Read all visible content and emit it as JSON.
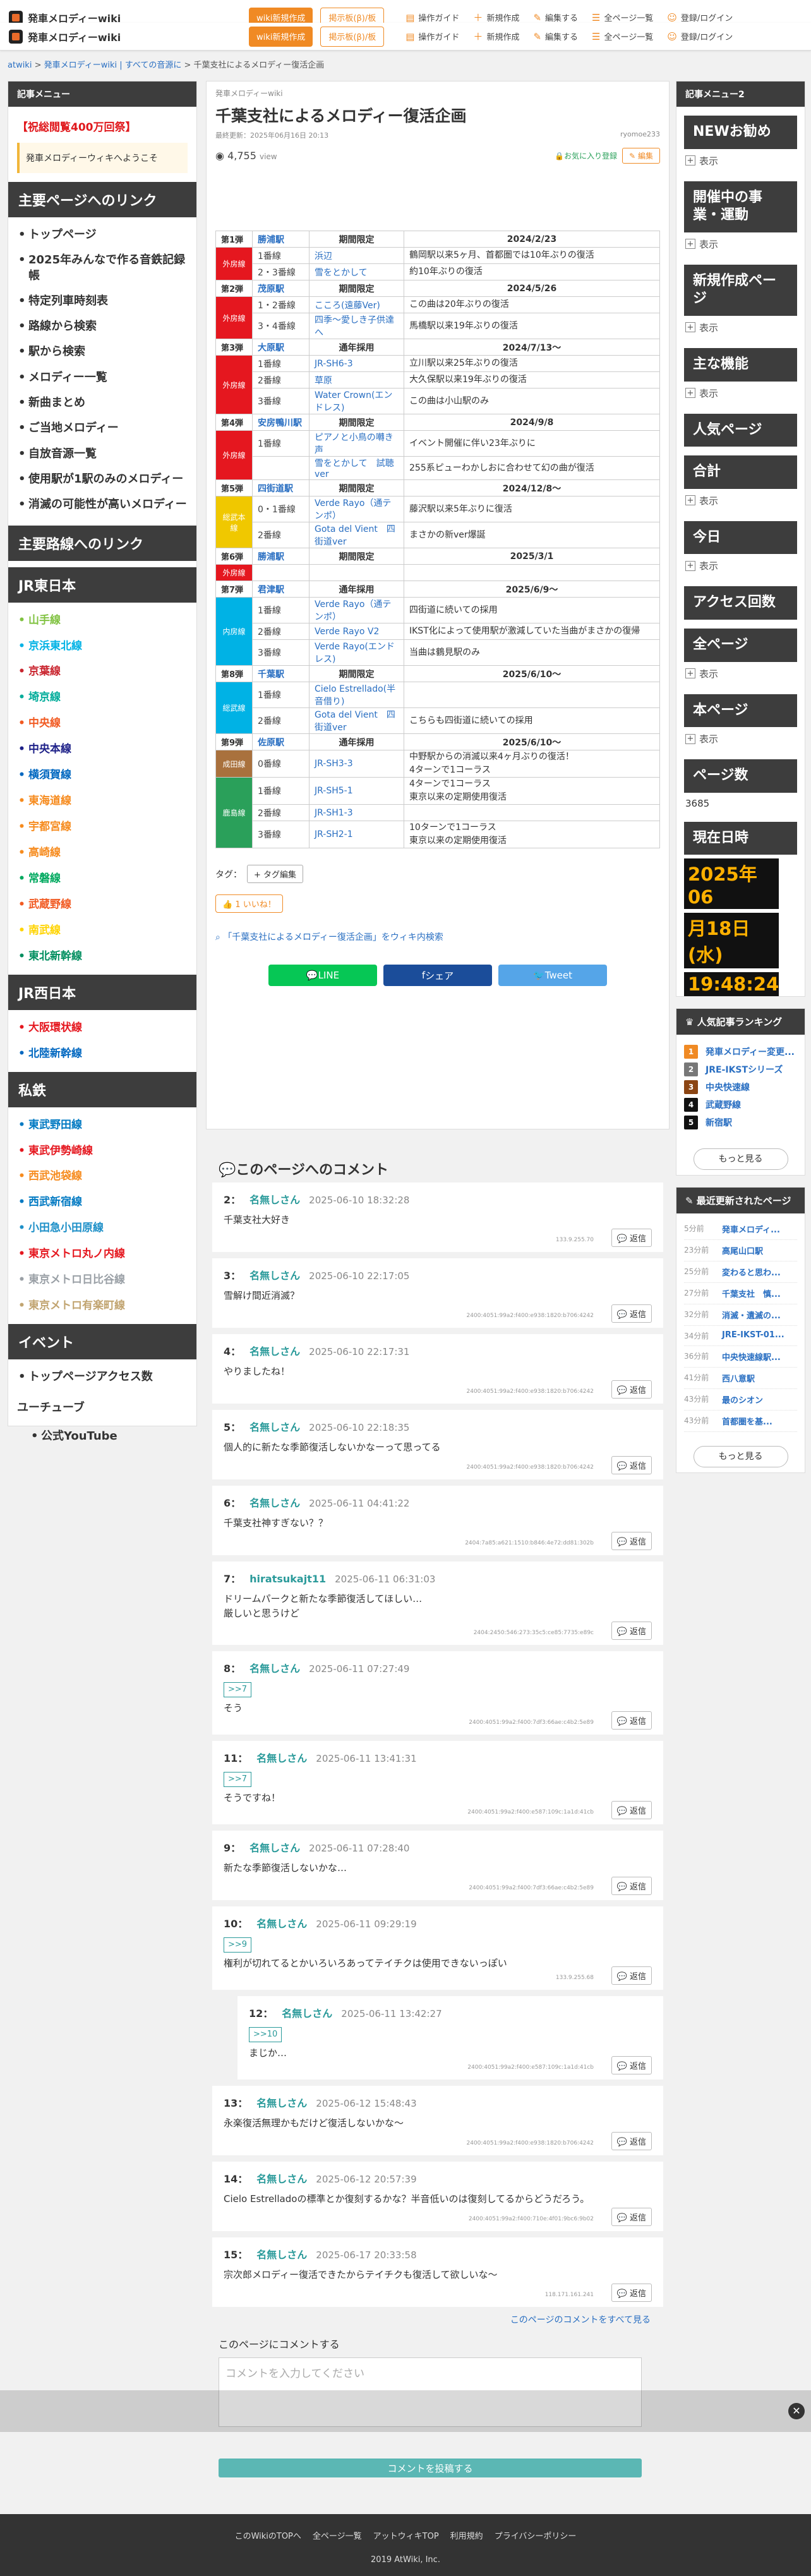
{
  "header": {
    "site_name": "発車メロディーwiki",
    "btn_wiki": "wiki新規作成",
    "btn_ad": "掲示板(β)/板",
    "links": [
      "操作ガイド",
      "新規作成",
      "編集する",
      "全ページ一覧",
      "登録/ログイン"
    ]
  },
  "breadcrumb": {
    "items": [
      "atwiki",
      "発車メロディーwiki | すべての音源に",
      "千葉支社によるメロディー復活企画"
    ]
  },
  "left": {
    "header": "記事メニュー",
    "notice": "【祝総閲覧400万回祭】",
    "welcome": "発車メロディーウィキへようこそ",
    "main_links_hd": "主要ページへのリンク",
    "main_links": [
      "トップページ",
      "2025年みんなで作る音鉄記録帳",
      "特定列車時刻表",
      "路線から検索",
      "駅から検索",
      "メロディー一覧",
      "新曲まとめ",
      "ご当地メロディー",
      "自放音源一覧",
      "使用駅が1駅のみのメロディー",
      "消滅の可能性が高いメロディー"
    ],
    "route_links_hd": "主要路線へのリンク",
    "jre_hd": "JR東日本",
    "jre": [
      {
        "t": "山手線",
        "c": "#80c241"
      },
      {
        "t": "京浜東北線",
        "c": "#00b2e5"
      },
      {
        "t": "京葉線",
        "c": "#c9252f"
      },
      {
        "t": "埼京線",
        "c": "#00ac9a"
      },
      {
        "t": "中央線",
        "c": "#f15a22"
      },
      {
        "t": "中央本線",
        "c": "#1d2088"
      },
      {
        "t": "横須賀線",
        "c": "#0067c0"
      },
      {
        "t": "東海道線",
        "c": "#f68b1e"
      },
      {
        "t": "宇都宮線",
        "c": "#f68b1e"
      },
      {
        "t": "高崎線",
        "c": "#f68b1e"
      },
      {
        "t": "常磐線",
        "c": "#00a95f"
      },
      {
        "t": "武蔵野線",
        "c": "#f15a22"
      },
      {
        "t": "南武線",
        "c": "#ffd400"
      },
      {
        "t": "東北新幹線",
        "c": "#008e5f"
      }
    ],
    "jrw_hd": "JR西日本",
    "jrw": [
      {
        "t": "大阪環状線",
        "c": "#e5171f"
      },
      {
        "t": "北陸新幹線",
        "c": "#0067c0"
      }
    ],
    "pvt_hd": "私鉄",
    "pvt": [
      {
        "t": "東武野田線",
        "c": "#0079c2"
      },
      {
        "t": "東武伊勢崎線",
        "c": "#e5171f"
      },
      {
        "t": "西武池袋線",
        "c": "#f68b1e"
      },
      {
        "t": "西武新宿線",
        "c": "#0079c2"
      },
      {
        "t": "小田急小田原線",
        "c": "#1e90c8"
      },
      {
        "t": "東京メトロ丸ノ内線",
        "c": "#e5171f"
      },
      {
        "t": "東京メトロ日比谷線",
        "c": "#9aa0a6"
      },
      {
        "t": "東京メトロ有楽町線",
        "c": "#c1a470"
      }
    ],
    "event_hd": "イベント",
    "event": [
      "トップページアクセス数"
    ],
    "youtuber": "ユーチューブ",
    "youtube": "公式YouTube"
  },
  "main": {
    "sub": "発車メロディーwiki",
    "title": "千葉支社によるメロディー復活企画",
    "updated": "最終更新：2025年06月16日 20:13",
    "author": "ryomoe233",
    "views": "4,755",
    "views_unit": "view",
    "fav": "お気に入り登録",
    "edit": "編集",
    "table": [
      {
        "type": "h",
        "ep": "第1弾",
        "st": "勝浦駅",
        "per": "期間限定",
        "date": "2024/2/23"
      },
      {
        "type": "r",
        "lc": "外房線",
        "col": "#e5171f",
        "span": 2,
        "trk": "1番線",
        "mel": "浜辺",
        "note": "鶴岡駅以来5ヶ月、首都圏では10年ぶりの復活"
      },
      {
        "type": "r2",
        "trk": "2・3番線",
        "mel": "雪をとかして",
        "note": "約10年ぶりの復活"
      },
      {
        "type": "h",
        "ep": "第2弾",
        "st": "茂原駅",
        "per": "期間限定",
        "date": "2024/5/26"
      },
      {
        "type": "r",
        "lc": "外房線",
        "col": "#e5171f",
        "span": 2,
        "trk": "1・2番線",
        "mel": "こころ(遠藤Ver)",
        "note": "この曲は20年ぶりの復活"
      },
      {
        "type": "r2",
        "trk": "3・4番線",
        "mel": "四季〜愛しき子供達へ",
        "note": "馬橋駅以来19年ぶりの復活"
      },
      {
        "type": "h",
        "ep": "第3弾",
        "st": "大原駅",
        "per": "通年採用",
        "date": "2024/7/13〜"
      },
      {
        "type": "r",
        "lc": "外房線",
        "col": "#e5171f",
        "span": 3,
        "trk": "1番線",
        "mel": "JR-SH6-3",
        "note": "立川駅以来25年ぶりの復活"
      },
      {
        "type": "r2",
        "trk": "2番線",
        "mel": "草原",
        "note": "大久保駅以来19年ぶりの復活"
      },
      {
        "type": "r2",
        "trk": "3番線",
        "mel": "Water Crown(エンドレス)",
        "note": "この曲は小山駅のみ"
      },
      {
        "type": "h",
        "ep": "第4弾",
        "st": "安房鴨川駅",
        "per": "期間限定",
        "date": "2024/9/8"
      },
      {
        "type": "r",
        "lc": "外房線",
        "col": "#e5171f",
        "span": 2,
        "trk": "1番線",
        "mel": "ピアノと小鳥の囀き声",
        "note": "イベント開催に伴い23年ぶりに"
      },
      {
        "type": "r2",
        "trk": "",
        "mel": "雪をとかして　試聴ver",
        "note": "255系ピューわかしおに合わせて幻の曲が復活"
      },
      {
        "type": "h",
        "ep": "第5弾",
        "st": "四街道駅",
        "per": "期間限定",
        "date": "2024/12/8〜"
      },
      {
        "type": "r",
        "lc": "総武本線",
        "col": "#f0c800",
        "span": 2,
        "trk": "0・1番線",
        "mel": "Verde Rayo（通テンポ）",
        "note": "藤沢駅以来5年ぶりに復活"
      },
      {
        "type": "r2",
        "trk": "2番線",
        "mel": "Gota del Vient　四街道ver",
        "note": "まさかの新ver爆誕"
      },
      {
        "type": "h",
        "ep": "第6弾",
        "st": "勝浦駅",
        "per": "期間限定",
        "date": "2025/3/1"
      },
      {
        "type": "r",
        "lc": "外房線",
        "col": "#e5171f",
        "span": 1,
        "trk": "",
        "mel": "",
        "note": ""
      },
      {
        "type": "h",
        "ep": "第7弾",
        "st": "君津駅",
        "per": "通年採用",
        "date": "2025/6/9〜"
      },
      {
        "type": "r",
        "lc": "内房線",
        "col": "#00b2e5",
        "span": 3,
        "trk": "1番線",
        "mel": "Verde Rayo（通テンポ）",
        "note": "四街道に続いての採用"
      },
      {
        "type": "r2",
        "trk": "2番線",
        "mel": "Verde Rayo V2",
        "note": "IKST化によって使用駅が激減していた当曲がまさかの復帰"
      },
      {
        "type": "r2",
        "trk": "3番線",
        "mel": "Verde Rayo(エンドレス)",
        "note": "当曲は鶴見駅のみ"
      },
      {
        "type": "h",
        "ep": "第8弾",
        "st": "千葉駅",
        "per": "期間限定",
        "date": "2025/6/10〜"
      },
      {
        "type": "r",
        "lc": "総武線",
        "col": "#00b2e5",
        "span": 2,
        "trk": "1番線",
        "mel": "Cielo Estrellado(半音借り)",
        "note": ""
      },
      {
        "type": "r2",
        "trk": "2番線",
        "mel": "Gota del Vient　四街道ver",
        "note": "こちらも四街道に続いての採用"
      },
      {
        "type": "h",
        "ep": "第9弾",
        "st": "佐原駅",
        "per": "通年採用",
        "date": "2025/6/10〜"
      },
      {
        "type": "r",
        "lc": "成田線",
        "col": "#a9713d",
        "span": 1,
        "trk": "0番線",
        "mel": "JR-SH3-3",
        "note": "中野駅からの消滅以来4ヶ月ぶりの復活！\n4ターンで1コーラス"
      },
      {
        "type": "r",
        "lc": "鹿島線",
        "col": "#2aa05a",
        "span": 3,
        "trk": "1番線",
        "mel": "JR-SH5-1",
        "note": "4ターンで1コーラス\n東京以来の定期使用復活"
      },
      {
        "type": "r2",
        "trk": "2番線",
        "mel": "JR-SH1-3",
        "note": ""
      },
      {
        "type": "r2",
        "trk": "3番線",
        "mel": "JR-SH2-1",
        "note": "10ターンで1コーラス\n東京以来の定期使用復活"
      }
    ],
    "tags_label": "タグ：",
    "tag_btn": "+ タグ編集",
    "like": "1 いいね！",
    "wiki_link": "「千葉支社によるメロディー復活企画」をウィキ内検索",
    "share": [
      "LINE",
      "シェア",
      "Tweet"
    ]
  },
  "comments": {
    "header": "このページへのコメント",
    "reply": "返信",
    "items": [
      {
        "num": "2：",
        "name": "名無しさん",
        "date": "2025-06-10 18:32:28",
        "body": "千葉支社大好き",
        "ip": "133.9.255.70"
      },
      {
        "num": "3：",
        "name": "名無しさん",
        "date": "2025-06-10 22:17:05",
        "body": "雪解け間近消滅？",
        "ip": "2400:4051:99a2:f400:e938:1820:b706:4242"
      },
      {
        "num": "4：",
        "name": "名無しさん",
        "date": "2025-06-10 22:17:31",
        "body": "やりましたね！",
        "ip": "2400:4051:99a2:f400:e938:1820:b706:4242"
      },
      {
        "num": "5：",
        "name": "名無しさん",
        "date": "2025-06-10 22:18:35",
        "body": "個人的に新たな季節復活しないかなーって思ってる",
        "ip": "2400:4051:99a2:f400:e938:1820:b706:4242"
      },
      {
        "num": "6：",
        "name": "名無しさん",
        "date": "2025-06-11 04:41:22",
        "body": "千葉支社神すぎない？？",
        "ip": "2404:7a85:a621:1510:b846:4e72:dd81:302b"
      },
      {
        "num": "7：",
        "name": "hiratsukajt11",
        "date": "2025-06-11 06:31:03",
        "body": "ドリームパークと新たな季節復活してほしい…\n厳しいと思うけど",
        "ip": "2404:2450:546:273:35c5:ce85:7735:e89c"
      },
      {
        "num": "8：",
        "name": "名無しさん",
        "date": "2025-06-11 07:27:49",
        "anchor": ">>7",
        "body": "そう",
        "ip": "2400:4051:99a2:f400:7df3:66ae:c4b2:5e89"
      },
      {
        "num": "11：",
        "name": "名無しさん",
        "date": "2025-06-11 13:41:31",
        "anchor": ">>7",
        "body": "そうですね！",
        "ip": "2400:4051:99a2:f400:e587:109c:1a1d:41cb"
      },
      {
        "num": "9：",
        "name": "名無しさん",
        "date": "2025-06-11 07:28:40",
        "body": "新たな季節復活しないかな…",
        "ip": "2400:4051:99a2:f400:7df3:66ae:c4b2:5e89"
      },
      {
        "num": "10：",
        "name": "名無しさん",
        "date": "2025-06-11 09:29:19",
        "anchor": ">>9",
        "body": "権利が切れてるとかいろいろあってテイチクは使用できないっぽい",
        "ip": "133.9.255.68"
      },
      {
        "num": "12：",
        "name": "名無しさん",
        "date": "2025-06-11 13:42:27",
        "anchor": ">>10",
        "body": "まじか…",
        "ip": "2400:4051:99a2:f400:e587:109c:1a1d:41cb",
        "indent": true
      },
      {
        "num": "13：",
        "name": "名無しさん",
        "date": "2025-06-12 15:48:43",
        "body": "永楽復活無理かもだけど復活しないかな〜",
        "ip": "2400:4051:99a2:f400:e938:1820:b706:4242"
      },
      {
        "num": "14：",
        "name": "名無しさん",
        "date": "2025-06-12 20:57:39",
        "body": "Cielo Estrelladoの標準とか復刻するかな？半音低いのは復刻してるからどうだろう。",
        "ip": "2400:4051:99a2:f400:710e:4f01:9bc6:9b02"
      },
      {
        "num": "15：",
        "name": "名無しさん",
        "date": "2025-06-17 20:33:58",
        "body": "宗次郎メロディー復活できたからテイチクも復活して欲しいな〜",
        "ip": "118.171.161.241"
      }
    ],
    "all_link": "このページのコメントをすべて見る",
    "form_label": "このページにコメントする",
    "placeholder": "コメントを入力してください",
    "post": "コメントを投稿する"
  },
  "right": {
    "header": "記事メニュー2",
    "sections": [
      {
        "hd": "NEWお勧め",
        "exp": "表示"
      },
      {
        "hd": "開催中の事業・運動",
        "exp": "表示"
      },
      {
        "hd": "新規作成ページ",
        "exp": "表示"
      },
      {
        "hd": "主な機能",
        "exp": "表示"
      },
      {
        "hd": "人気ページ",
        "exp": ""
      },
      {
        "hd": "合計",
        "exp": "表示"
      },
      {
        "hd": "今日",
        "exp": "表示"
      },
      {
        "hd": "アクセス回数",
        "exp": ""
      },
      {
        "hd": "全ページ",
        "exp": "表示"
      },
      {
        "hd": "本ページ",
        "exp": "表示"
      },
      {
        "hd": "ページ数",
        "exp": ""
      }
    ],
    "page_count": "3685",
    "now_hd": "現在日時",
    "date1": "2025年06",
    "date2": "月18日 (水)",
    "time": "19:48:24",
    "rank_hd": "人気記事ランキング",
    "rank": [
      {
        "n": "1",
        "t": "発車メロディー変更...",
        "c": "#f08a24"
      },
      {
        "n": "2",
        "t": "JRE-IKSTシリーズ",
        "c": "#777"
      },
      {
        "n": "3",
        "t": "中央快速線",
        "c": "#8b4513"
      },
      {
        "n": "4",
        "t": "武蔵野線",
        "c": "#111"
      },
      {
        "n": "5",
        "t": "新宿駅",
        "c": "#111"
      }
    ],
    "more": "もっと見る",
    "upd_hd": "最近更新されたページ",
    "upd": [
      {
        "a": "5分前",
        "t": "発車メロディ..."
      },
      {
        "a": "23分前",
        "t": "高尾山口駅"
      },
      {
        "a": "25分前",
        "t": "変わると思わ..."
      },
      {
        "a": "27分前",
        "t": "千葉支社　慎..."
      },
      {
        "a": "32分前",
        "t": "消滅・遺滅の..."
      },
      {
        "a": "34分前",
        "t": "JRE-IKST-01..."
      },
      {
        "a": "36分前",
        "t": "中央快速線駅..."
      },
      {
        "a": "41分前",
        "t": "西八意駅"
      },
      {
        "a": "43分前",
        "t": "最のシオン"
      },
      {
        "a": "43分前",
        "t": "首都圏を基..."
      }
    ]
  },
  "footer": {
    "links": [
      "このWikiのTOPへ",
      "全ページ一覧",
      "アットウィキTOP",
      "利用規約",
      "プライバシーポリシー"
    ],
    "copy": "2019 AtWiki, Inc."
  }
}
